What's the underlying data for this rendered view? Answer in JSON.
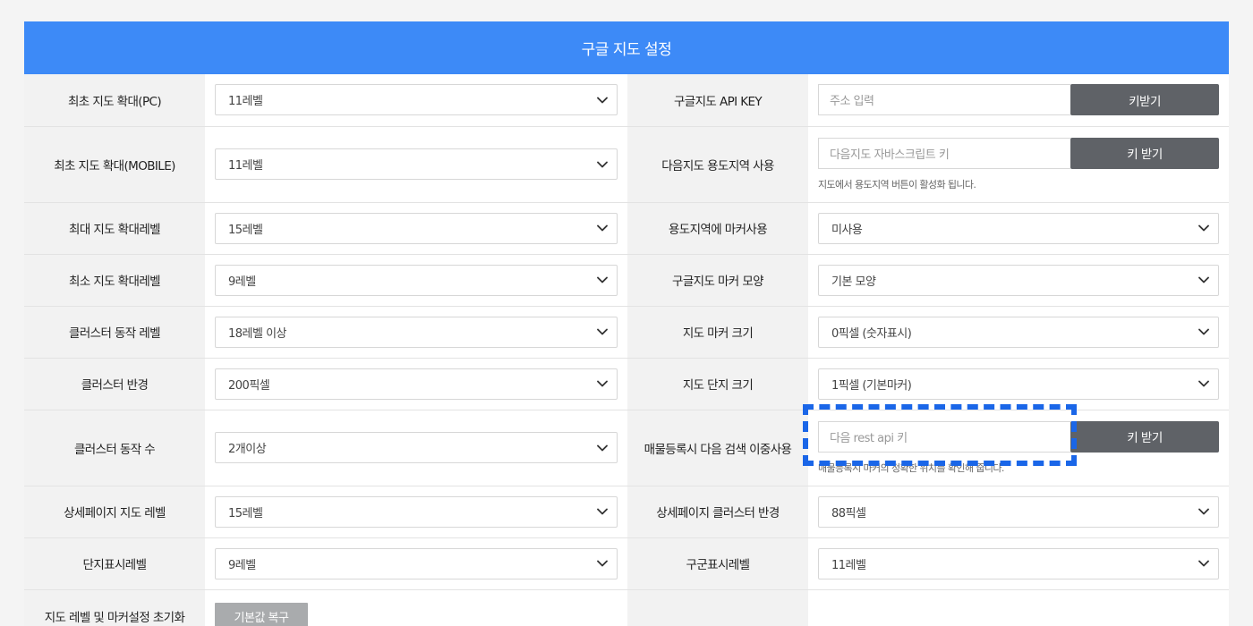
{
  "title": "구글 지도 설정",
  "rows": [
    {
      "left": {
        "label": "최초 지도 확대(PC)",
        "value": "11레벨"
      },
      "right": {
        "label": "구글지도 API KEY",
        "placeholder": "주소 입력",
        "button": "키받기"
      }
    },
    {
      "left": {
        "label": "최초 지도 확대(MOBILE)",
        "value": "11레벨"
      },
      "right": {
        "label": "다음지도 용도지역 사용",
        "placeholder": "다음지도 자바스크립트 키",
        "button": "키 받기",
        "help": "지도에서 용도지역 버튼이 활성화 됩니다."
      }
    },
    {
      "left": {
        "label": "최대 지도 확대레벨",
        "value": "15레벨"
      },
      "right": {
        "label": "용도지역에 마커사용",
        "value": "미사용"
      }
    },
    {
      "left": {
        "label": "최소 지도 확대레벨",
        "value": "9레벨"
      },
      "right": {
        "label": "구글지도 마커 모양",
        "value": "기본 모양"
      }
    },
    {
      "left": {
        "label": "클러스터 동작 레벨",
        "value": "18레벨 이상"
      },
      "right": {
        "label": "지도 마커 크기",
        "value": "0픽셀 (숫자표시)"
      }
    },
    {
      "left": {
        "label": "클러스터 반경",
        "value": "200픽셀"
      },
      "right": {
        "label": "지도 단지 크기",
        "value": "1픽셀 (기본마커)"
      }
    },
    {
      "left": {
        "label": "클러스터 동작 수",
        "value": "2개이상"
      },
      "right": {
        "label": "매물등록시 다음 검색 이중사용",
        "placeholder": "다음 rest api 키",
        "button": "키 받기",
        "help": "매물등록시 마커의 정확한 위치를 확인해 줍니다."
      }
    },
    {
      "left": {
        "label": "상세페이지 지도 레벨",
        "value": "15레벨"
      },
      "right": {
        "label": "상세페이지 클러스터 반경",
        "value": "88픽셀"
      }
    },
    {
      "left": {
        "label": "단지표시레벨",
        "value": "9레벨"
      },
      "right": {
        "label": "구군표시레벨",
        "value": "11레벨"
      }
    },
    {
      "left": {
        "label": "지도 레벨 및 마커설정 초기화",
        "button": "기본값 복구"
      }
    }
  ],
  "icons": {
    "select_arrow": "chevron-down-icon"
  },
  "colors": {
    "header": "#3d8af7",
    "key_button": "#5f6267",
    "restore_button": "#a9abad",
    "highlight": "#1a66e8"
  }
}
